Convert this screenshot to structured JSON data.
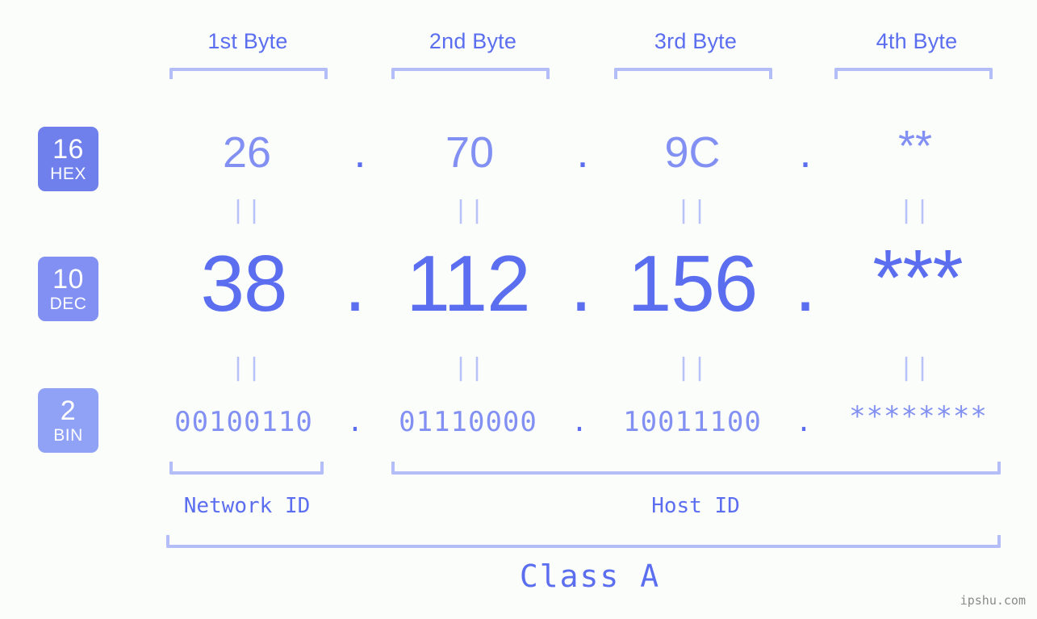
{
  "page": {
    "background_color": "#fbfdfa",
    "accent_color": "#5b6ef0",
    "light_accent_color": "#b3bdf8",
    "watermark": "ipshu.com"
  },
  "byte_headers": [
    {
      "label": "1st Byte"
    },
    {
      "label": "2nd Byte"
    },
    {
      "label": "3rd Byte"
    },
    {
      "label": "4th Byte"
    }
  ],
  "bases": [
    {
      "number": "16",
      "name": "HEX",
      "color": "#6f7fec"
    },
    {
      "number": "10",
      "name": "DEC",
      "color": "#8190f2"
    },
    {
      "number": "2",
      "name": "BIN",
      "color": "#8fa2f5"
    }
  ],
  "rows": {
    "hex": {
      "base_number": "16",
      "base_name": "HEX",
      "values": [
        "26",
        "70",
        "9C",
        "**"
      ],
      "separator": "."
    },
    "dec": {
      "base_number": "10",
      "base_name": "DEC",
      "values": [
        "38",
        "112",
        "156",
        "***"
      ],
      "separator": "."
    },
    "bin": {
      "base_number": "2",
      "base_name": "BIN",
      "values": [
        "00100110",
        "01110000",
        "10011100",
        "********"
      ],
      "separator": "."
    }
  },
  "equality_marks": [
    "||",
    "||",
    "||",
    "||",
    "||",
    "||",
    "||",
    "||"
  ],
  "sections": {
    "network_id": "Network ID",
    "host_id": "Host ID",
    "class": "Class A"
  }
}
